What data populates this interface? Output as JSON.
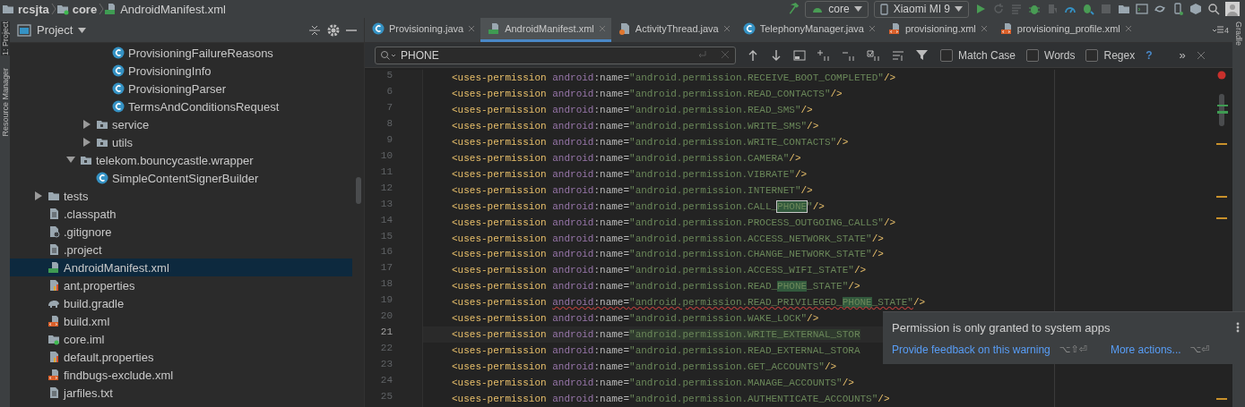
{
  "breadcrumb": [
    {
      "label": "rcsjta",
      "kind": "folder"
    },
    {
      "label": "core",
      "kind": "module"
    },
    {
      "label": "AndroidManifest.xml",
      "kind": "manifest"
    }
  ],
  "toolbar": {
    "configuration": "core",
    "device": "Xiaomi MI 9"
  },
  "tool_strips": {
    "left": [
      "1: Project",
      "Resource Manager"
    ],
    "right": [
      "Gradle"
    ]
  },
  "project": {
    "title": "Project",
    "tree": [
      {
        "children": [
          {
            "children": [
              {
                "children": [
                  {
                    "children": [
                      {
                        "label": "ProvisioningFailureReasons",
                        "kind": "class",
                        "selected": false
                      },
                      {
                        "label": "ProvisioningInfo",
                        "kind": "class",
                        "selected": false
                      },
                      {
                        "label": "ProvisioningParser",
                        "kind": "class",
                        "selected": false
                      },
                      {
                        "label": "TermsAndConditionsRequest",
                        "kind": "class",
                        "selected": false
                      }
                    ]
                  },
                  {
                    "label": "service",
                    "kind": "package",
                    "expanded": false,
                    "selected": false
                  },
                  {
                    "label": "utils",
                    "kind": "package",
                    "expanded": false,
                    "selected": false
                  }
                ]
              },
              {
                "label": "telekom.bouncycastle.wrapper",
                "kind": "package",
                "expanded": true,
                "selected": false,
                "children": [
                  {
                    "label": "SimpleContentSignerBuilder",
                    "kind": "class",
                    "selected": false
                  }
                ]
              }
            ]
          }
        ]
      },
      {
        "label": "tests",
        "kind": "folder",
        "expanded": false,
        "selected": false
      },
      {
        "label": ".classpath",
        "kind": "file",
        "selected": false
      },
      {
        "label": ".gitignore",
        "kind": "gitignore",
        "selected": false
      },
      {
        "label": ".project",
        "kind": "file",
        "selected": false
      },
      {
        "label": "AndroidManifest.xml",
        "kind": "manifest",
        "selected": true
      },
      {
        "label": "ant.properties",
        "kind": "properties",
        "selected": false
      },
      {
        "label": "build.gradle",
        "kind": "gradle",
        "selected": false
      },
      {
        "label": "build.xml",
        "kind": "xml",
        "selected": false
      },
      {
        "label": "core.iml",
        "kind": "iml",
        "selected": false
      },
      {
        "label": "default.properties",
        "kind": "properties",
        "selected": false
      },
      {
        "label": "findbugs-exclude.xml",
        "kind": "xml",
        "selected": false
      },
      {
        "label": "jarfiles.txt",
        "kind": "file",
        "selected": false
      }
    ]
  },
  "editor_tabs": [
    {
      "label": "Provisioning.java",
      "kind": "class",
      "selected": false
    },
    {
      "label": "AndroidManifest.xml",
      "kind": "manifest",
      "selected": true
    },
    {
      "label": "ActivityThread.java",
      "kind": "java",
      "selected": false
    },
    {
      "label": "TelephonyManager.java",
      "kind": "class",
      "selected": false
    },
    {
      "label": "provisioning.xml",
      "kind": "xml",
      "selected": false
    },
    {
      "label": "provisioning_profile.xml",
      "kind": "xml",
      "selected": false
    }
  ],
  "tab_overflow": "4",
  "find": {
    "value": "PHONE",
    "options": [
      {
        "label": "Match Case",
        "checked": false
      },
      {
        "label": "Words",
        "checked": false
      },
      {
        "label": "Regex",
        "checked": false
      }
    ],
    "help": "?",
    "more": "»"
  },
  "code": [
    {
      "number": "5",
      "tag": "<uses-permission",
      "ns": "android",
      "attr": ":name=",
      "value": [
        {
          "text": "\"android.permission.RECEIVE_BOOT_COMPLETED\"",
          "match": false,
          "current": false
        }
      ],
      "close": "/>",
      "warning": false,
      "caret": false
    },
    {
      "number": "6",
      "tag": "<uses-permission",
      "ns": "android",
      "attr": ":name=",
      "value": [
        {
          "text": "\"android.permission.READ_CONTACTS\"",
          "match": false,
          "current": false
        }
      ],
      "close": "/>",
      "warning": false,
      "caret": false
    },
    {
      "number": "7",
      "tag": "<uses-permission",
      "ns": "android",
      "attr": ":name=",
      "value": [
        {
          "text": "\"android.permission.READ_SMS\"",
          "match": false,
          "current": false
        }
      ],
      "close": "/>",
      "warning": false,
      "caret": false
    },
    {
      "number": "8",
      "tag": "<uses-permission",
      "ns": "android",
      "attr": ":name=",
      "value": [
        {
          "text": "\"android.permission.WRITE_SMS\"",
          "match": false,
          "current": false
        }
      ],
      "close": "/>",
      "warning": false,
      "caret": false
    },
    {
      "number": "9",
      "tag": "<uses-permission",
      "ns": "android",
      "attr": ":name=",
      "value": [
        {
          "text": "\"android.permission.WRITE_CONTACTS\"",
          "match": false,
          "current": false
        }
      ],
      "close": "/>",
      "warning": false,
      "caret": false
    },
    {
      "number": "10",
      "tag": "<uses-permission",
      "ns": "android",
      "attr": ":name=",
      "value": [
        {
          "text": "\"android.permission.CAMERA\"",
          "match": false,
          "current": false
        }
      ],
      "close": "/>",
      "warning": false,
      "caret": false
    },
    {
      "number": "11",
      "tag": "<uses-permission",
      "ns": "android",
      "attr": ":name=",
      "value": [
        {
          "text": "\"android.permission.VIBRATE\"",
          "match": false,
          "current": false
        }
      ],
      "close": "/>",
      "warning": false,
      "caret": false
    },
    {
      "number": "12",
      "tag": "<uses-permission",
      "ns": "android",
      "attr": ":name=",
      "value": [
        {
          "text": "\"android.permission.INTERNET\"",
          "match": false,
          "current": false
        }
      ],
      "close": "/>",
      "warning": false,
      "caret": false
    },
    {
      "number": "13",
      "tag": "<uses-permission",
      "ns": "android",
      "attr": ":name=",
      "value": [
        {
          "text": "\"android.permission.CALL_",
          "match": false,
          "current": false
        },
        {
          "text": "PHONE",
          "match": true,
          "current": true
        },
        {
          "text": "\"",
          "match": false,
          "current": false
        }
      ],
      "close": "/>",
      "warning": false,
      "caret": false
    },
    {
      "number": "14",
      "tag": "<uses-permission",
      "ns": "android",
      "attr": ":name=",
      "value": [
        {
          "text": "\"android.permission.PROCESS_OUTGOING_CALLS\"",
          "match": false,
          "current": false
        }
      ],
      "close": "/>",
      "warning": false,
      "caret": false
    },
    {
      "number": "15",
      "tag": "<uses-permission",
      "ns": "android",
      "attr": ":name=",
      "value": [
        {
          "text": "\"android.permission.ACCESS_NETWORK_STATE\"",
          "match": false,
          "current": false
        }
      ],
      "close": "/>",
      "warning": false,
      "caret": false
    },
    {
      "number": "16",
      "tag": "<uses-permission",
      "ns": "android",
      "attr": ":name=",
      "value": [
        {
          "text": "\"android.permission.CHANGE_NETWORK_STATE\"",
          "match": false,
          "current": false
        }
      ],
      "close": "/>",
      "warning": false,
      "caret": false
    },
    {
      "number": "17",
      "tag": "<uses-permission",
      "ns": "android",
      "attr": ":name=",
      "value": [
        {
          "text": "\"android.permission.ACCESS_WIFI_STATE\"",
          "match": false,
          "current": false
        }
      ],
      "close": "/>",
      "warning": false,
      "caret": false
    },
    {
      "number": "18",
      "tag": "<uses-permission",
      "ns": "android",
      "attr": ":name=",
      "value": [
        {
          "text": "\"android.permission.READ_",
          "match": false,
          "current": false
        },
        {
          "text": "PHONE",
          "match": true,
          "current": false
        },
        {
          "text": "_STATE\"",
          "match": false,
          "current": false
        }
      ],
      "close": "/>",
      "warning": false,
      "caret": false
    },
    {
      "number": "19",
      "tag": "<uses-permission",
      "ns": "android",
      "attr": ":name=",
      "value": [
        {
          "text": "\"android.permission.READ_PRIVILEGED_",
          "match": false,
          "current": false
        },
        {
          "text": "PHONE",
          "match": true,
          "current": false
        },
        {
          "text": "_STATE\"",
          "match": false,
          "current": false
        }
      ],
      "close": "/>",
      "warning": true,
      "caret": false
    },
    {
      "number": "20",
      "tag": "<uses-permission",
      "ns": "android",
      "attr": ":name=",
      "value": [
        {
          "text": "\"android.permission.WAKE_LOCK\"",
          "match": false,
          "current": false
        }
      ],
      "close": "/>",
      "warning": false,
      "caret": false
    },
    {
      "number": "21",
      "tag": "<uses-permission",
      "ns": "android",
      "attr": ":name=",
      "value": [
        {
          "text": "\"android.permission.WRITE_EXTERNAL_STOR",
          "match": false,
          "current": false
        }
      ],
      "warning": false,
      "caret": true
    },
    {
      "number": "22",
      "tag": "<uses-permission",
      "ns": "android",
      "attr": ":name=",
      "value": [
        {
          "text": "\"android.permission.READ_EXTERNAL_STORA",
          "match": false,
          "current": false
        }
      ],
      "warning": false,
      "caret": false
    },
    {
      "number": "23",
      "tag": "<uses-permission",
      "ns": "android",
      "attr": ":name=",
      "value": [
        {
          "text": "\"android.permission.GET_ACCOUNTS\"",
          "match": false,
          "current": false
        }
      ],
      "close": "/>",
      "warning": false,
      "caret": false
    },
    {
      "number": "24",
      "tag": "<uses-permission",
      "ns": "android",
      "attr": ":name=",
      "value": [
        {
          "text": "\"android.permission.MANAGE_ACCOUNTS\"",
          "match": false,
          "current": false
        }
      ],
      "close": "/>",
      "warning": false,
      "caret": false
    },
    {
      "number": "25",
      "tag": "<uses-permission",
      "ns": "android",
      "attr": ":name=",
      "value": [
        {
          "text": "\"android.permission.AUTHENTICATE_ACCOUNTS\"",
          "match": false,
          "current": false
        }
      ],
      "close": "/>",
      "warning": false,
      "caret": false
    }
  ],
  "popup": {
    "message": "Permission is only granted to system apps",
    "actions": [
      {
        "label": "Provide feedback on this warning",
        "shortcut": "⌥⇧⏎"
      },
      {
        "label": "More actions...",
        "shortcut": "⌥⏎"
      }
    ]
  }
}
